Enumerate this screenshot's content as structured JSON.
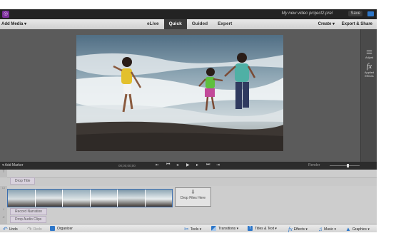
{
  "titlebar": {
    "logo_glyph": "◎",
    "project_name": "My new video project2.prel",
    "save_label": "Save"
  },
  "modebar": {
    "add_media_label": "Add Media ▾",
    "modes": [
      "eLive",
      "Quick",
      "Guided",
      "Expert"
    ],
    "active_mode": "Quick",
    "create_label": "Create ▾",
    "export_label": "Export & Share"
  },
  "side_panel": {
    "adjust_label": "Adjust",
    "adjust_glyph": "⚌",
    "applied_effects_label": "Applied Effects",
    "fx_glyph": "fx"
  },
  "transport": {
    "add_marker_label": "▾ Add Marker",
    "timecode": "00;00;00;00",
    "render_label": "Render"
  },
  "timeline": {
    "title_track_label": "Drop Title",
    "narration_label": "Record Narration",
    "audio_label": "Drop Audio Clips",
    "drop_files_label": "Drop Files Here"
  },
  "bottombar": {
    "undo_label": "Undo",
    "redo_label": "Redo",
    "organizer_label": "Organizer",
    "tools_label": "Tools ▾",
    "transitions_label": "Transitions ▾",
    "titles_label": "Titles & Text ▾",
    "effects_label": "Effects ▾",
    "music_label": "Music ▾",
    "graphics_label": "Graphics ▾"
  },
  "colors": {
    "accent_blue": "#2e77c9",
    "logo_purple": "#7b2f9a"
  }
}
